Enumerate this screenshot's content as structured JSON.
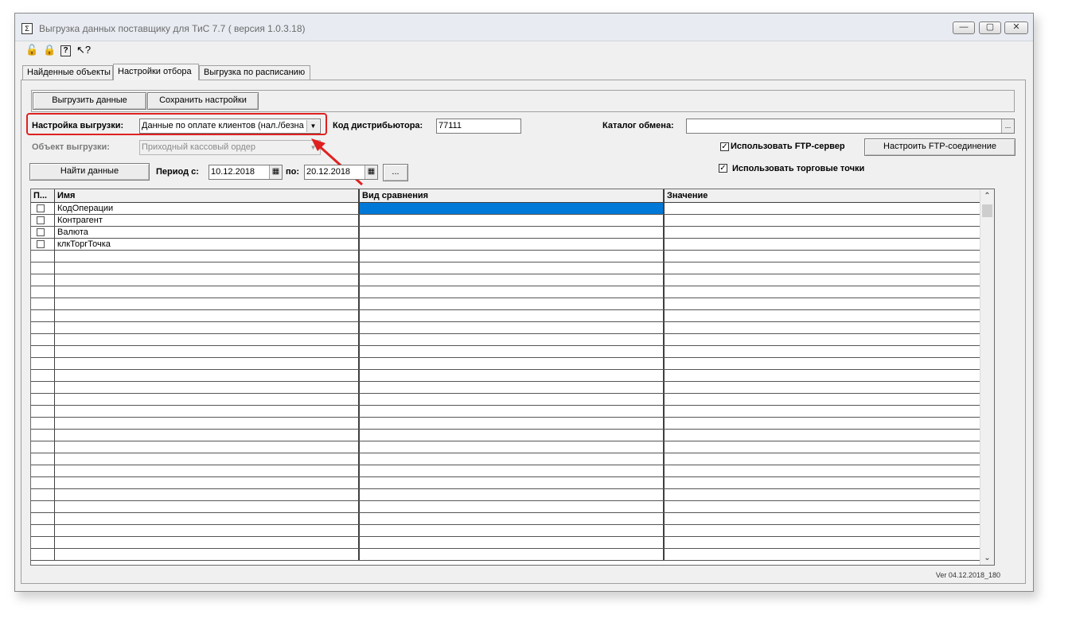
{
  "window": {
    "title": "Выгрузка данных поставщику для ТиС 7.7 ( версия 1.0.3.18)",
    "minimize": "—",
    "maximize": "▢",
    "close": "✕"
  },
  "toolbar": {
    "icons": [
      "lock-open-icon",
      "lock-icon",
      "help-icon",
      "context-help-icon"
    ]
  },
  "tabs": [
    {
      "label": "Найденные объекты"
    },
    {
      "label": "Настройки отбора",
      "active": true
    },
    {
      "label": "Выгрузка по расписанию"
    }
  ],
  "actions": {
    "export_label": "Выгрузить данные",
    "save_label": "Сохранить настройки"
  },
  "form": {
    "export_setting_label": "Настройка выгрузки:",
    "export_setting_value": "Данные по оплате клиентов (нал./безна",
    "distributor_code_label": "Код дистрибьютора:",
    "distributor_code_value": "77111",
    "exchange_catalog_label": "Каталог обмена:",
    "exchange_catalog_value": "",
    "object_label": "Объект выгрузки:",
    "object_value": "Приходный кассовый ордер",
    "use_ftp_label": "Использовать FTP-сервер",
    "use_ftp_checked": true,
    "ftp_setup_label": "Настроить FTP-соединение",
    "use_trade_points_label": "Использовать торговые точки",
    "use_trade_points_checked": true,
    "find_data_label": "Найти данные",
    "period_from_label": "Период с:",
    "period_from_value": "10.12.2018",
    "period_to_label": "по:",
    "period_to_value": "20.12.2018",
    "ellipsis": "...",
    "browse": "..."
  },
  "grid": {
    "columns": [
      "П...",
      "Имя",
      "Вид сравнения",
      "Значение"
    ],
    "rows": [
      {
        "name": "КодОперации",
        "comparison": "",
        "value": ""
      },
      {
        "name": "Контрагент",
        "comparison": "",
        "value": ""
      },
      {
        "name": "Валюта",
        "comparison": "",
        "value": ""
      },
      {
        "name": "клкТоргТочка",
        "comparison": "",
        "value": ""
      }
    ]
  },
  "footer": {
    "version": "Ver 04.12.2018_180"
  },
  "colors": {
    "highlight": "#e02020",
    "selection": "#0078d7"
  }
}
